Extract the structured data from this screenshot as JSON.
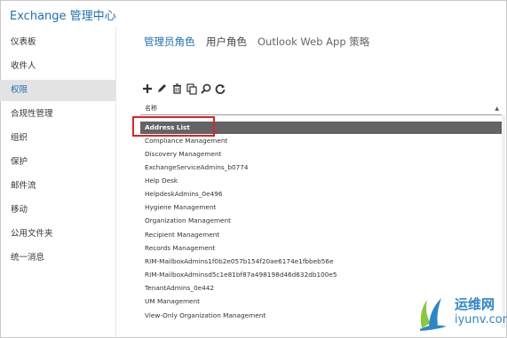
{
  "app": {
    "title": "Exchange 管理中心"
  },
  "sidebar": {
    "items": [
      {
        "label": "仪表板",
        "active": false
      },
      {
        "label": "收件人",
        "active": false
      },
      {
        "label": "权限",
        "active": true
      },
      {
        "label": "合规性管理",
        "active": false
      },
      {
        "label": "组织",
        "active": false
      },
      {
        "label": "保护",
        "active": false
      },
      {
        "label": "邮件流",
        "active": false
      },
      {
        "label": "移动",
        "active": false
      },
      {
        "label": "公用文件夹",
        "active": false
      },
      {
        "label": "统一消息",
        "active": false
      }
    ]
  },
  "tabs": [
    {
      "label": "管理员角色",
      "active": true
    },
    {
      "label": "用户角色",
      "active": false
    },
    {
      "label": "Outlook Web App 策略",
      "active": false
    }
  ],
  "toolbar": {
    "tools": [
      "add-icon",
      "edit-icon",
      "delete-icon",
      "copy-icon",
      "search-icon",
      "refresh-icon"
    ]
  },
  "table": {
    "column_header": "名称",
    "sort_arrow": "▲",
    "rows": [
      {
        "name": "Address List",
        "selected": true
      },
      {
        "name": "Compliance Management"
      },
      {
        "name": "Discovery Management"
      },
      {
        "name": "ExchangeServiceAdmins_b0774"
      },
      {
        "name": "Help Desk"
      },
      {
        "name": "HelpdeskAdmins_0e496"
      },
      {
        "name": "Hygiene Management"
      },
      {
        "name": "Organization Management"
      },
      {
        "name": "Recipient Management"
      },
      {
        "name": "Records Management"
      },
      {
        "name": "RIM-MailboxAdmins1f0b2e057b154f20ae6174e1fbbeb56e"
      },
      {
        "name": "RIM-MailboxAdminsd5c1e81bf87a498198d46d632db100e5"
      },
      {
        "name": "TenantAdmins_0e442"
      },
      {
        "name": "UM Management"
      },
      {
        "name": "View-Only Organization Management"
      }
    ]
  },
  "watermark": {
    "cn": "运维网",
    "en": "iyunv.com"
  },
  "colors": {
    "accent": "#1f6fb6",
    "selected_row": "#646464",
    "highlight": "#d9252a"
  }
}
